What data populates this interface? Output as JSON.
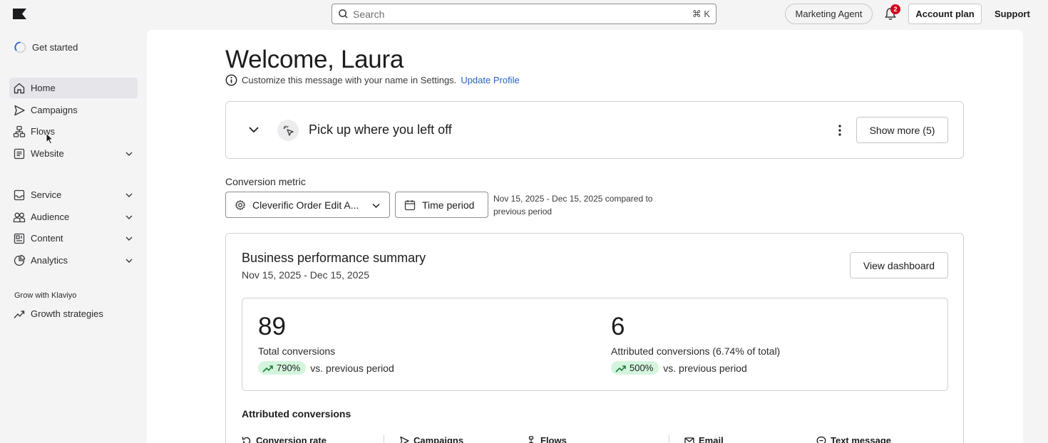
{
  "topbar": {
    "search_placeholder": "Search",
    "search_shortcut": "⌘ K",
    "agent_label": "Marketing Agent",
    "notification_count": "2",
    "account_label": "Account plan",
    "support_label": "Support"
  },
  "sidebar": {
    "get_started": "Get started",
    "items": [
      {
        "label": "Home",
        "icon": "home-icon",
        "active": true
      },
      {
        "label": "Campaigns",
        "icon": "send-icon"
      },
      {
        "label": "Flows",
        "icon": "flows-icon"
      },
      {
        "label": "Website",
        "icon": "website-icon",
        "expandable": true
      },
      {
        "label": "Service",
        "icon": "inbox-icon",
        "expandable": true
      },
      {
        "label": "Audience",
        "icon": "audience-icon",
        "expandable": true
      },
      {
        "label": "Content",
        "icon": "content-icon",
        "expandable": true
      },
      {
        "label": "Analytics",
        "icon": "analytics-icon",
        "expandable": true
      }
    ],
    "section_label": "Grow with Klaviyo",
    "growth": "Growth strategies"
  },
  "main": {
    "welcome": "Welcome, Laura",
    "customize_text": "Customize this message with your name in Settings.",
    "customize_link": "Update Profile",
    "pickup_title": "Pick up where you left off",
    "show_more": "Show more (5)",
    "conversion_label": "Conversion metric",
    "metric_value": "Cleverific Order Edit A...",
    "time_period": "Time period",
    "date_note": "Nov 15, 2025 - Dec 15, 2025 compared to previous period",
    "bps_title": "Business performance summary",
    "bps_range": "Nov 15, 2025 - Dec 15, 2025",
    "view_dashboard": "View dashboard",
    "stats": [
      {
        "value": "89",
        "label": "Total conversions",
        "change": "790%",
        "vs": "vs. previous period"
      },
      {
        "value": "6",
        "label": "Attributed conversions (6.74% of total)",
        "change": "500%",
        "vs": "vs. previous period"
      }
    ],
    "attributed_label": "Attributed conversions",
    "subtabs": [
      "Conversion rate",
      "Campaigns",
      "Flows",
      "Email",
      "Text message"
    ]
  },
  "colors": {
    "accent_link": "#2563c9",
    "badge": "#d0021b",
    "pill": "#d4f5dd"
  }
}
